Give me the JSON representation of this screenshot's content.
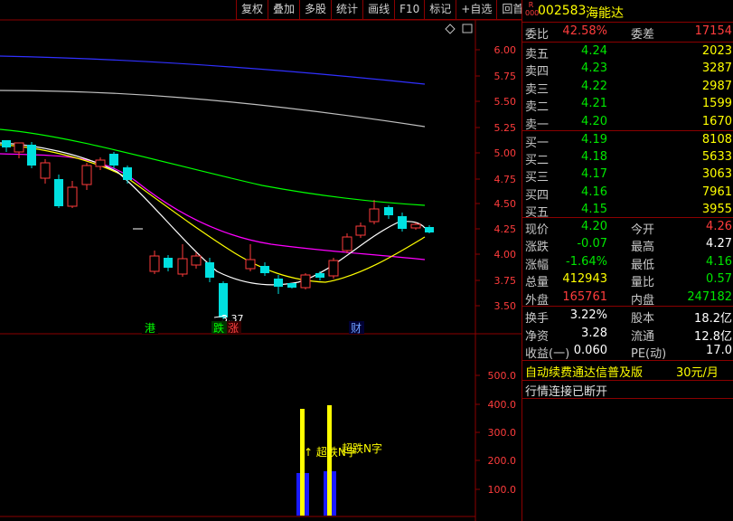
{
  "toolbar": {
    "items": [
      "复权",
      "叠加",
      "多股",
      "统计",
      "画线",
      "F10",
      "标记",
      "+自选",
      "回首页"
    ]
  },
  "header": {
    "badge_top": "R",
    "badge_bottom": "000",
    "code": "002583",
    "name": "海能达"
  },
  "price_axis": [
    "6.00",
    "5.75",
    "5.50",
    "5.25",
    "5.00",
    "4.75",
    "4.50",
    "4.25",
    "4.00",
    "3.75",
    "3.50"
  ],
  "low_marker": "3.37",
  "event_tags": [
    {
      "text": "港",
      "color": "#00ff00"
    },
    {
      "text": "跌",
      "color": "#00ff00"
    },
    {
      "text": "涨",
      "color": "#ff4040"
    },
    {
      "text": "财",
      "color": "#6fa0ff"
    }
  ],
  "indicator_axis": [
    "500.0",
    "400.0",
    "300.0",
    "200.0",
    "100.0"
  ],
  "signal_labels": [
    "↑ 超跌N字",
    "超跌N字"
  ],
  "quote": {
    "wei_bi_label": "委比",
    "wei_bi_value": "42.58%",
    "wei_cha_label": "委差",
    "wei_cha_value": "17154",
    "asks": [
      {
        "label": "卖五",
        "price": "4.24",
        "vol": "2023"
      },
      {
        "label": "卖四",
        "price": "4.23",
        "vol": "3287"
      },
      {
        "label": "卖三",
        "price": "4.22",
        "vol": "2987"
      },
      {
        "label": "卖二",
        "price": "4.21",
        "vol": "1599"
      },
      {
        "label": "卖一",
        "price": "4.20",
        "vol": "1670"
      }
    ],
    "bids": [
      {
        "label": "买一",
        "price": "4.19",
        "vol": "8108"
      },
      {
        "label": "买二",
        "price": "4.18",
        "vol": "5633"
      },
      {
        "label": "买三",
        "price": "4.17",
        "vol": "3063"
      },
      {
        "label": "买四",
        "price": "4.16",
        "vol": "7961"
      },
      {
        "label": "买五",
        "price": "4.15",
        "vol": "3955"
      }
    ],
    "stats1": [
      {
        "l1": "现价",
        "v1": "4.20",
        "c1": "green",
        "l2": "今开",
        "v2": "4.26",
        "c2": "red"
      },
      {
        "l1": "涨跌",
        "v1": "-0.07",
        "c1": "green",
        "l2": "最高",
        "v2": "4.27",
        "c2": "white"
      },
      {
        "l1": "涨幅",
        "v1": "-1.64%",
        "c1": "green",
        "l2": "最低",
        "v2": "4.16",
        "c2": "green"
      },
      {
        "l1": "总量",
        "v1": "412943",
        "c1": "yellow",
        "l2": "量比",
        "v2": "0.57",
        "c2": "green"
      },
      {
        "l1": "外盘",
        "v1": "165761",
        "c1": "red",
        "l2": "内盘",
        "v2": "247182",
        "c2": "green"
      }
    ],
    "stats2": [
      {
        "l1": "换手",
        "v1": "3.22%",
        "l2": "股本",
        "v2": "18.2亿"
      },
      {
        "l1": "净资",
        "v1": "3.28",
        "l2": "流通",
        "v2": "12.8亿"
      },
      {
        "l1": "收益(一)",
        "v1": "0.060",
        "l2": "PE(动)",
        "v2": "17.0"
      }
    ],
    "promo_text": "自动续费通达信普及版",
    "promo_price": "30元/月",
    "status": "行情连接已断开"
  },
  "colors": {
    "up": "#ff3c3c",
    "down": "#00e0e0",
    "ma5": "#ffffff",
    "ma10": "#ffff00",
    "ma20": "#ff00ff",
    "ma60": "#00ff00",
    "ma120": "#c0c0c0",
    "ma250": "#3030ff",
    "border": "#8b0000"
  }
}
